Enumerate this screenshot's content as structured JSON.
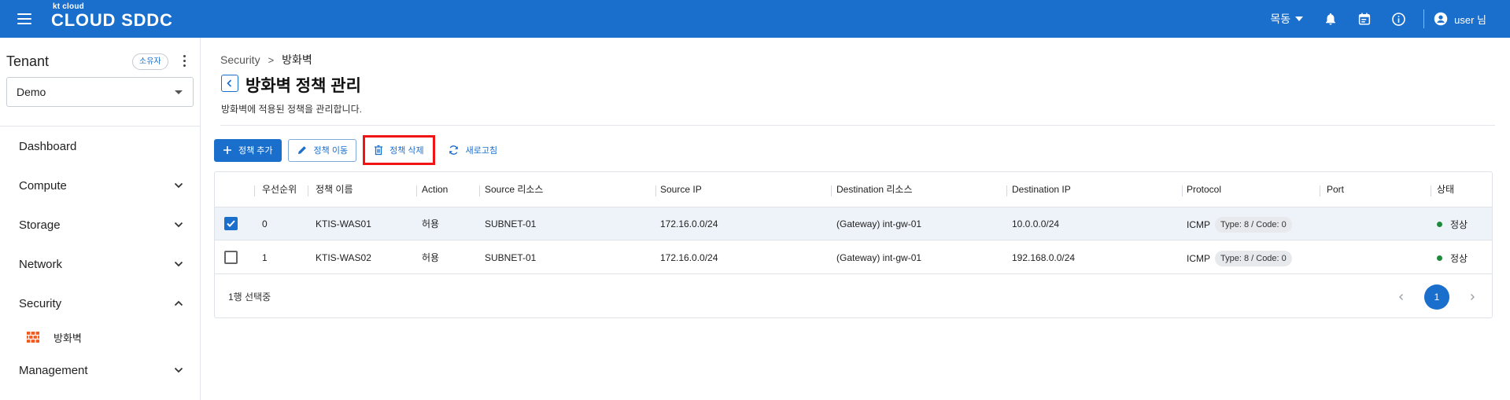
{
  "topbar": {
    "logo_small": "kt cloud",
    "logo_brand": "CLOUD SDDC",
    "region": "목동",
    "user": "user 님"
  },
  "sidebar": {
    "tenant_title": "Tenant",
    "owner_badge": "소유자",
    "tenant_selected": "Demo",
    "nav": [
      {
        "label": "Dashboard"
      },
      {
        "label": "Compute"
      },
      {
        "label": "Storage"
      },
      {
        "label": "Network"
      },
      {
        "label": "Security"
      },
      {
        "label": "Management"
      }
    ],
    "security_sub": {
      "label": "방화벽"
    }
  },
  "breadcrumb": {
    "parent": "Security",
    "separator": ">",
    "current": "방화벽"
  },
  "page": {
    "title": "방화벽 정책 관리",
    "description": "방화벽에 적용된 정책을 관리합니다."
  },
  "toolbar": {
    "add_label": "정책 추가",
    "move_label": "정책 이동",
    "delete_label": "정책 삭제",
    "refresh_label": "새로고침"
  },
  "table": {
    "columns": [
      "우선순위",
      "정책 이름",
      "Action",
      "Source 리소스",
      "Source IP",
      "Destination 리소스",
      "Destination IP",
      "Protocol",
      "Port",
      "상태"
    ],
    "rows": [
      {
        "checked": true,
        "priority": "0",
        "name": "KTIS-WAS01",
        "action": "허용",
        "src_res": "SUBNET-01",
        "src_ip": "172.16.0.0/24",
        "dst_res": "(Gateway) int-gw-01",
        "dst_ip": "10.0.0.0/24",
        "protocol": "ICMP",
        "type_code": "Type: 8 / Code: 0",
        "port": "",
        "status": "정상"
      },
      {
        "checked": false,
        "priority": "1",
        "name": "KTIS-WAS02",
        "action": "허용",
        "src_res": "SUBNET-01",
        "src_ip": "172.16.0.0/24",
        "dst_res": "(Gateway) int-gw-01",
        "dst_ip": "192.168.0.0/24",
        "protocol": "ICMP",
        "type_code": "Type: 8 / Code: 0",
        "port": "",
        "status": "정상"
      }
    ],
    "selection_text": "1행 선택중",
    "page": "1"
  },
  "colors": {
    "primary": "#1a6fcd",
    "highlight": "#f01414",
    "status_ok": "#1f8a3b"
  }
}
